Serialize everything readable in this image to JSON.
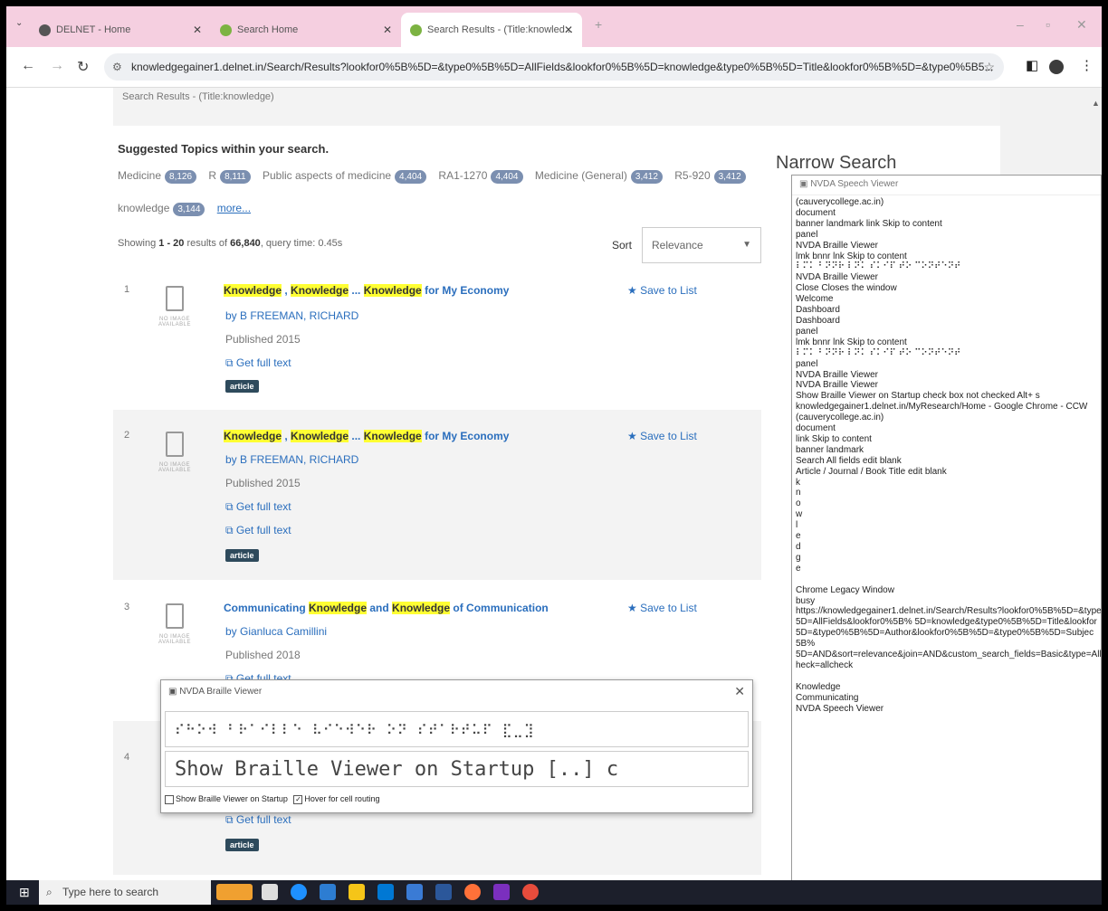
{
  "browser": {
    "tabs": [
      {
        "label": "DELNET - Home",
        "active": false
      },
      {
        "label": "Search Home",
        "active": false
      },
      {
        "label": "Search Results - (Title:knowled...",
        "active": true
      }
    ],
    "url": "knowledgegainer1.delnet.in/Search/Results?lookfor0%5B%5D=&type0%5B%5D=AllFields&lookfor0%5B%5D=knowledge&type0%5B%5D=Title&lookfor0%5B%5D=&type0%5B5..."
  },
  "page": {
    "breadcrumb": "Search Results - (Title:knowledge)",
    "suggested_title": "Suggested Topics within your search.",
    "topics_row1": [
      {
        "name": "Medicine",
        "count": "8,126"
      },
      {
        "name": "R",
        "count": "8,111"
      },
      {
        "name": "Public aspects of medicine",
        "count": "4,404"
      },
      {
        "name": "RA1-1270",
        "count": "4,404"
      },
      {
        "name": "Medicine (General)",
        "count": "3,412"
      },
      {
        "name": "R5-920",
        "count": "3,412"
      }
    ],
    "topics_row2": [
      {
        "name": "knowledge",
        "count": "3,144"
      }
    ],
    "more_label": "more...",
    "showing_prefix": "Showing ",
    "showing_range": "1 - 20",
    "showing_mid": " results of ",
    "showing_total": "66,840",
    "showing_suffix": ", query time: 0.45s",
    "sort_label": "Sort",
    "sort_value": "Relevance",
    "narrow_title": "Narrow Search",
    "save_label": "Save to List",
    "no_image_label": "NO IMAGE AVAILABLE",
    "results": [
      {
        "num": "1",
        "title_parts": [
          "Knowledge",
          " , ",
          "Knowledge",
          " ... ",
          "Knowledge",
          " for My Economy"
        ],
        "author": "by B FREEMAN, RICHARD",
        "published": "Published 2015",
        "links": [
          "Get full text"
        ],
        "format": "article"
      },
      {
        "num": "2",
        "title_parts": [
          "Knowledge",
          " , ",
          "Knowledge",
          " ... ",
          "Knowledge",
          " for My Economy"
        ],
        "author": "by B FREEMAN, RICHARD",
        "published": "Published 2015",
        "links": [
          "Get full text",
          "Get full text"
        ],
        "format": "article"
      },
      {
        "num": "3",
        "title_parts": [
          "Communicating ",
          "Knowledge",
          " and ",
          "Knowledge",
          " of Communication"
        ],
        "author": "by Gianluca Camillini",
        "published": "Published 2018",
        "links": [
          "Get full text"
        ],
        "format": "article"
      },
      {
        "num": "4",
        "links": [
          "Get full text"
        ],
        "format": "article"
      }
    ]
  },
  "speech_viewer": {
    "title": "NVDA Speech Viewer",
    "lines": [
      "(cauverycollege.ac.in)",
      "document",
      "banner landmark  link  Skip to content",
      "panel",
      "NVDA Braille Viewer",
      "lmk bnnr lnk Skip to content",
      "⠇⠍⠅ ⠃⠝⠝⠗ ⠇⠝⠅ ⠎⠅⠊⠏ ⠞⠕ ⠉⠕⠝⠞⠑⠝⠞",
      "NVDA Braille Viewer",
      "Close Closes the window",
      "Welcome",
      " Dashboard",
      " Dashboard",
      "panel",
      "lmk bnnr lnk Skip to content",
      "⠇⠍⠅ ⠃⠝⠝⠗ ⠇⠝⠅ ⠎⠅⠊⠏ ⠞⠕ ⠉⠕⠝⠞⠑⠝⠞",
      "panel",
      "NVDA Braille Viewer",
      "NVDA Braille Viewer",
      "Show Braille Viewer on Startup  check box  not checked  Alt+ s",
      "knowledgegainer1.delnet.in/MyResearch/Home - Google Chrome - CCW",
      "(cauverycollege.ac.in)",
      "document",
      "link  Skip to content",
      "banner landmark",
      "Search All fields  edit  blank",
      "Article / Journal / Book Title  edit  blank",
      "k",
      "n",
      "o",
      "w",
      "l",
      "e",
      "d",
      "g",
      "e",
      "",
      "Chrome Legacy Window",
      "busy",
      "https://knowledgegainer1.delnet.in/Search/Results?lookfor0%5B%5D=&type",
      "5D=AllFields&lookfor0%5B%  5D=knowledge&type0%5B%5D=Title&lookfor",
      "5D=&type0%5B%5D=Author&lookfor0%5B%5D=&type0%5B%5D=Subjec",
      "5B%",
      "5D=AND&sort=relevance&join=AND&custom_search_fields=Basic&type=All",
      "heck=allcheck",
      "",
      "Knowledge",
      "Communicating",
      "NVDA Speech Viewer"
    ]
  },
  "braille_viewer": {
    "title": "NVDA Braille Viewer",
    "dots": "⠎⠓⠕⠺ ⠃⠗⠁⠊⠇⠇⠑ ⠧⠊⠑⠺⠑⠗ ⠕⠝ ⠎⠞⠁⠗⠞⠥⠏ ⣏⣀⣹",
    "text": "Show Braille Viewer on Startup [..] c",
    "opt_startup": "Show Braille Viewer on Startup",
    "opt_hover": "Hover for cell routing"
  },
  "taskbar": {
    "search_placeholder": "Type here to search"
  },
  "colors": {
    "tabstrip": "#f5cfe0",
    "link": "#2a6ebd",
    "highlight": "#ffff33",
    "badge": "#7b8fb0",
    "taskbar": "#1c1f2b"
  }
}
